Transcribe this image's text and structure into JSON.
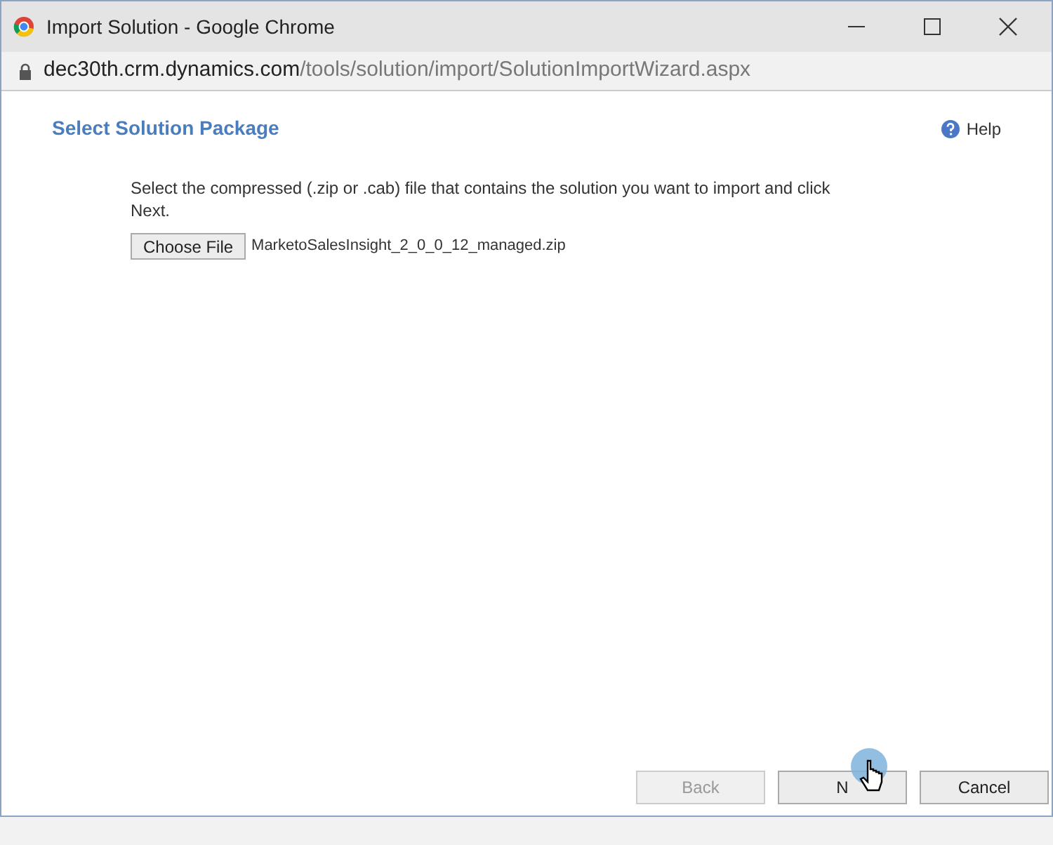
{
  "window": {
    "title": "Import Solution - Google Chrome"
  },
  "address_bar": {
    "host": "dec30th.crm.dynamics.com",
    "path": "/tools/solution/import/SolutionImportWizard.aspx"
  },
  "page": {
    "heading": "Select Solution Package",
    "help": "Help",
    "instruction": "Select the compressed (.zip or .cab) file that contains the solution you want to import and click Next.",
    "choose_button": "Choose File",
    "file_name": "MarketoSalesInsight_2_0_0_12_managed.zip"
  },
  "buttons": [
    {
      "label": "Back",
      "disabled": true
    },
    {
      "label": "N",
      "disabled": false
    },
    {
      "label": "Cancel",
      "disabled": false
    }
  ]
}
